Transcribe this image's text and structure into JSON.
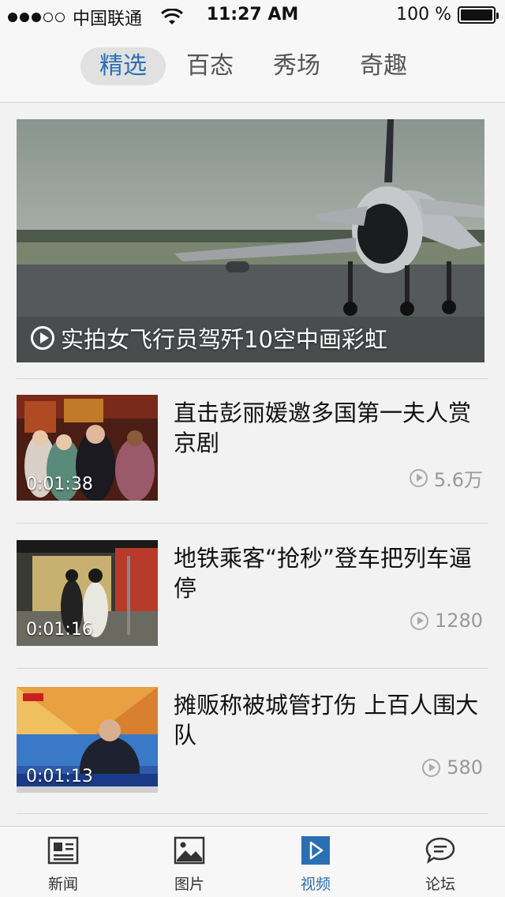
{
  "status_bar": {
    "carrier": "中国联通",
    "time": "11:27 AM",
    "battery": "100 %",
    "signal_dots_filled": 3,
    "signal_dots_total": 5
  },
  "top_tabs": [
    {
      "label": "精选",
      "active": true
    },
    {
      "label": "百态",
      "active": false
    },
    {
      "label": "秀场",
      "active": false
    },
    {
      "label": "奇趣",
      "active": false
    }
  ],
  "featured": {
    "caption": "实拍女飞行员驾歼10空中画彩虹",
    "icon": "play-circle-icon"
  },
  "videos": [
    {
      "title": "直击彭丽媛邀多国第一夫人赏京剧",
      "duration": "0:01:38",
      "views": "5.6万"
    },
    {
      "title": "地铁乘客“抢秒”登车把列车逼停",
      "duration": "0:01:16",
      "views": "1280"
    },
    {
      "title": "摊贩称被城管打伤 上百人围大队",
      "duration": "0:01:13",
      "views": "580"
    }
  ],
  "bottom_nav": [
    {
      "label": "新闻",
      "icon": "newspaper-icon",
      "active": false
    },
    {
      "label": "图片",
      "icon": "picture-icon",
      "active": false
    },
    {
      "label": "视频",
      "icon": "video-play-icon",
      "active": true
    },
    {
      "label": "论坛",
      "icon": "chat-bubble-icon",
      "active": false
    }
  ],
  "colors": {
    "accent": "#2a6fb3",
    "background": "#f2f2f2",
    "divider": "#d6d6d6",
    "muted_text": "#999999"
  }
}
